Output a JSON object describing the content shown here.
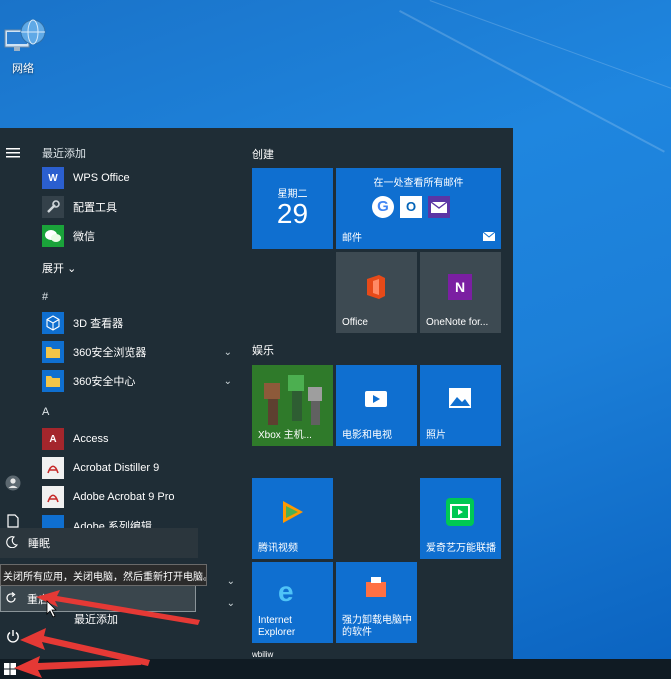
{
  "desktop": {
    "network_icon_label": "网络"
  },
  "start_menu": {
    "recent_header": "最近添加",
    "recent_apps": [
      {
        "label": "WPS Office",
        "icon": "wps-icon"
      },
      {
        "label": "配置工具",
        "icon": "tools-icon"
      },
      {
        "label": "微信",
        "icon": "wechat-icon"
      }
    ],
    "expand_label": "展开",
    "section_hash": "#",
    "hash_apps": [
      {
        "label": "3D 查看器",
        "icon": "cube-icon"
      },
      {
        "label": "360安全浏览器",
        "icon": "folder-icon"
      },
      {
        "label": "360安全中心",
        "icon": "folder-icon"
      }
    ],
    "section_a": "A",
    "a_apps": [
      {
        "label": "Access",
        "icon": "access-icon"
      },
      {
        "label": "Acrobat Distiller 9",
        "icon": "acrobat-icon"
      },
      {
        "label": "Adobe Acrobat 9 Pro",
        "icon": "acrobat-icon"
      },
      {
        "label": "Adobe 系列编辑",
        "icon": "adobe-icon"
      }
    ],
    "partial_item": "最近添加",
    "tiles": {
      "group_create": "创建",
      "calendar_day": "星期二",
      "calendar_date": "29",
      "mail_heading": "在一处查看所有邮件",
      "mail_label": "邮件",
      "office_label": "Office",
      "onenote_label": "OneNote for...",
      "group_entertainment": "娱乐",
      "xbox_label": "Xbox 主机...",
      "movies_label": "电影和电视",
      "photos_label": "照片",
      "tencent_label": "腾讯视频",
      "iqiyi_label": "爱奇艺万能联播",
      "ie_label": "Internet Explorer",
      "uninstall_label": "强力卸载电脑中的软件",
      "bottom_partial": "wbiliw"
    },
    "power_menu": {
      "sleep_label": "睡眠",
      "restart_label": "重启",
      "restart_tooltip": "关闭所有应用，关闭电脑，然后重新打开电脑。"
    }
  },
  "colors": {
    "tile_blue": "#0f6fd0",
    "menu_bg": "#1f2d36",
    "arrow_red": "#e53935"
  }
}
